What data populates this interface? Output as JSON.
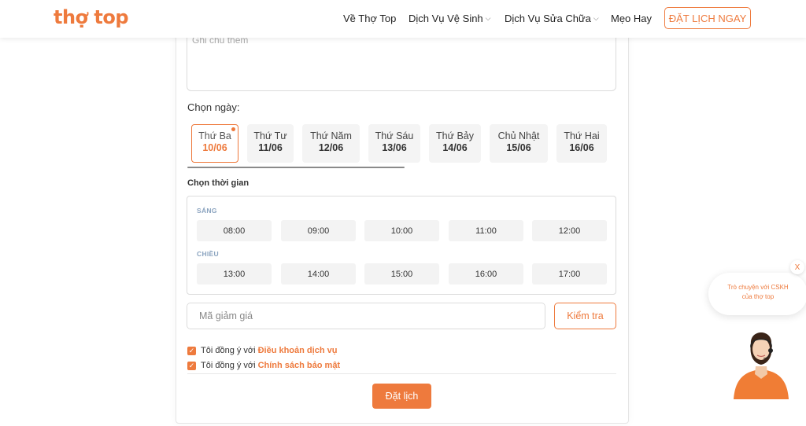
{
  "header": {
    "logo": "thợ top",
    "nav": [
      {
        "label": "Về Thợ Top",
        "dropdown": false
      },
      {
        "label": "Dịch Vụ Vệ Sinh",
        "dropdown": true
      },
      {
        "label": "Dịch Vụ Sửa Chữa",
        "dropdown": true
      },
      {
        "label": "Mẹo Hay",
        "dropdown": false
      }
    ],
    "book_button": "ĐẶT LỊCH NGAY"
  },
  "form": {
    "note_placeholder": "Ghi chú thêm",
    "choose_day_label": "Chọn ngày:",
    "days": [
      {
        "name": "Thứ Ba",
        "date": "10/06",
        "selected": true
      },
      {
        "name": "Thứ Tư",
        "date": "11/06"
      },
      {
        "name": "Thứ Năm",
        "date": "12/06"
      },
      {
        "name": "Thứ Sáu",
        "date": "13/06"
      },
      {
        "name": "Thứ Bảy",
        "date": "14/06"
      },
      {
        "name": "Chủ Nhật",
        "date": "15/06"
      },
      {
        "name": "Thứ Hai",
        "date": "16/06"
      }
    ],
    "choose_time_label": "Chọn thời gian",
    "morning_label": "SÁNG",
    "morning_slots": [
      "08:00",
      "09:00",
      "10:00",
      "11:00",
      "12:00"
    ],
    "afternoon_label": "CHIỀU",
    "afternoon_slots": [
      "13:00",
      "14:00",
      "15:00",
      "16:00",
      "17:00"
    ],
    "coupon_placeholder": "Mã giảm giá",
    "check_button": "Kiểm tra",
    "agree_prefix": "Tôi đồng ý với",
    "terms_link": "Điều khoản dịch vụ",
    "privacy_link": "Chính sách bảo mật",
    "submit_button": "Đặt lịch"
  },
  "chat": {
    "close": "X",
    "line1": "Trò chuyện với CSKH",
    "line2": "của thợ top"
  },
  "colors": {
    "accent": "#ee7a3d"
  }
}
